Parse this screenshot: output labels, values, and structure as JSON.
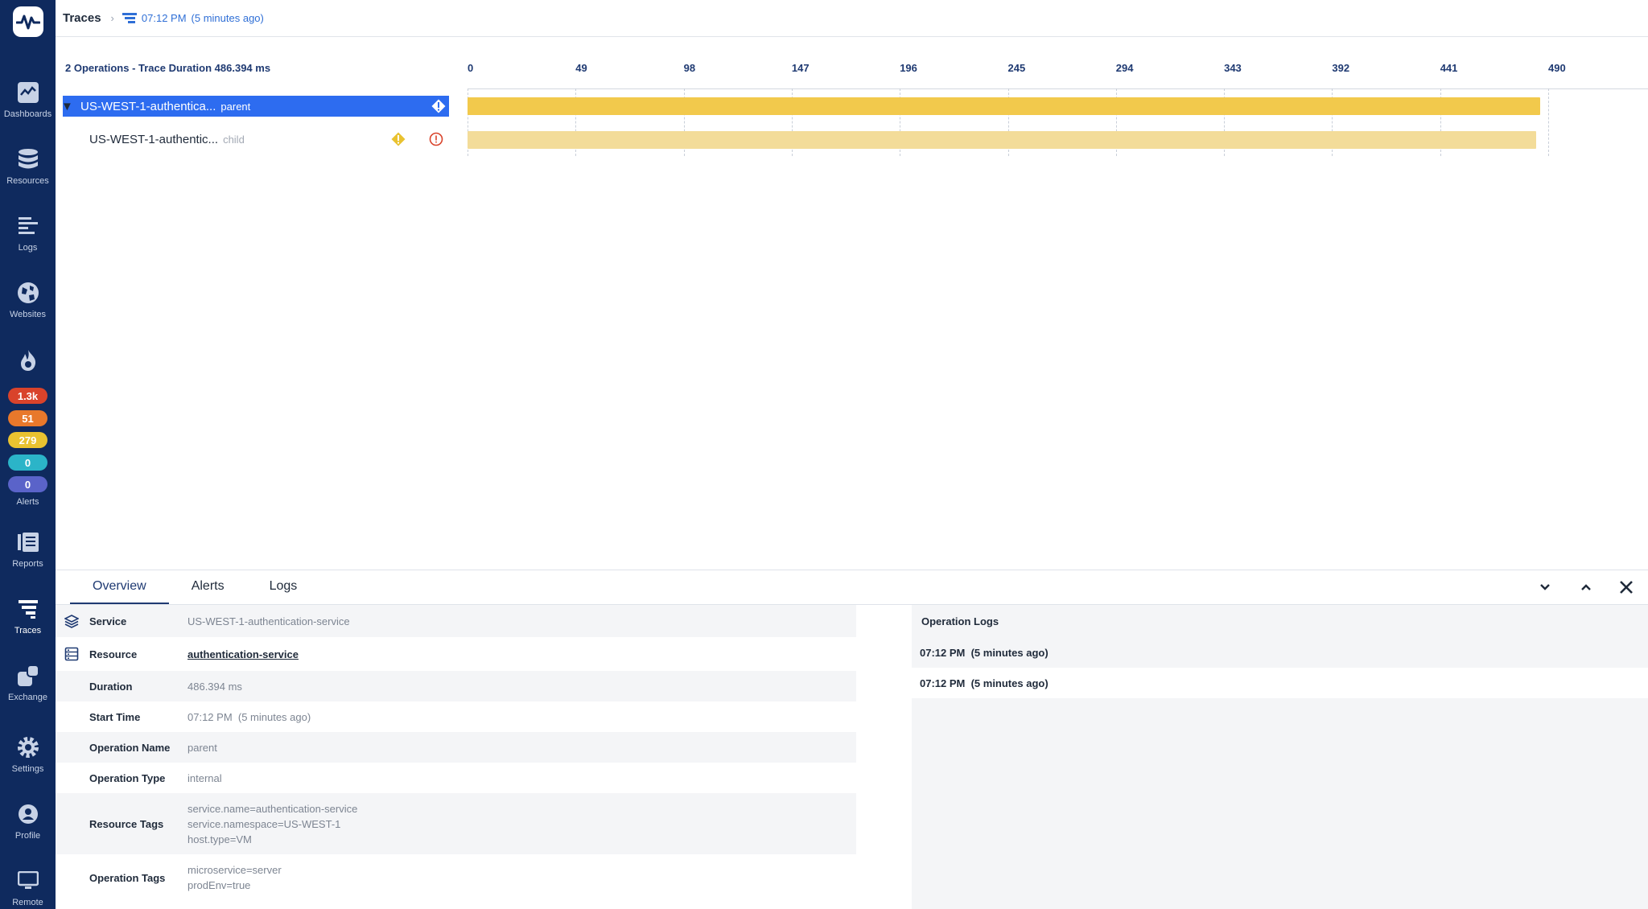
{
  "sidebar": {
    "items": [
      {
        "label": "Dashboards",
        "icon": "dashboards-icon"
      },
      {
        "label": "Resources",
        "icon": "resources-icon"
      },
      {
        "label": "Logs",
        "icon": "logs-icon"
      },
      {
        "label": "Websites",
        "icon": "websites-icon"
      },
      {
        "label": "Alerts",
        "icon": "flame-icon"
      },
      {
        "label": "Reports",
        "icon": "reports-icon"
      },
      {
        "label": "Traces",
        "icon": "traces-icon"
      },
      {
        "label": "Exchange",
        "icon": "exchange-icon"
      },
      {
        "label": "Settings",
        "icon": "gear-icon"
      },
      {
        "label": "Profile",
        "icon": "profile-icon"
      },
      {
        "label": "Remote",
        "icon": "monitor-icon"
      }
    ],
    "alert_badges": [
      {
        "value": "1.3k",
        "color": "#d9432b"
      },
      {
        "value": "51",
        "color": "#e8782b"
      },
      {
        "value": "279",
        "color": "#e9c230"
      },
      {
        "value": "0",
        "color": "#2bb4c8"
      },
      {
        "value": "0",
        "color": "#5a63c9"
      }
    ]
  },
  "breadcrumb": {
    "root": "Traces",
    "time": "07:12 PM",
    "relative": "(5 minutes ago)"
  },
  "trace": {
    "summary": "2 Operations - Trace Duration 486.394 ms",
    "ruler_ticks": [
      "0",
      "49",
      "98",
      "147",
      "196",
      "245",
      "294",
      "343",
      "392",
      "441",
      "490"
    ],
    "operations": [
      {
        "name": "US-WEST-1-authentica...",
        "tag": "parent",
        "selected": true,
        "start_ms": 0,
        "duration_ms": 486.394,
        "color": "#f2c94c"
      },
      {
        "name": "US-WEST-1-authentic...",
        "tag": "child",
        "selected": false,
        "start_ms": 0,
        "duration_ms": 484.5,
        "color": "#f3dc99"
      }
    ]
  },
  "panel": {
    "tabs": [
      "Overview",
      "Alerts",
      "Logs"
    ],
    "details": [
      {
        "key": "Service",
        "value": "US-WEST-1-authentication-service"
      },
      {
        "key": "Resource",
        "value": "authentication-service"
      },
      {
        "key": "Duration",
        "value": "486.394 ms"
      },
      {
        "key": "Start Time",
        "value": "07:12 PM  (5 minutes ago)"
      },
      {
        "key": "Operation Name",
        "value": "parent"
      },
      {
        "key": "Operation Type",
        "value": "internal"
      },
      {
        "key": "Resource Tags",
        "lines": [
          "service.name=authentication-service",
          "service.namespace=US-WEST-1",
          "host.type=VM"
        ]
      },
      {
        "key": "Operation Tags",
        "lines": [
          "microservice=server",
          "prodEnv=true"
        ]
      }
    ],
    "logs_title": "Operation Logs",
    "logs": [
      "07:12 PM  (5 minutes ago)",
      "07:12 PM  (5 minutes ago)"
    ]
  }
}
